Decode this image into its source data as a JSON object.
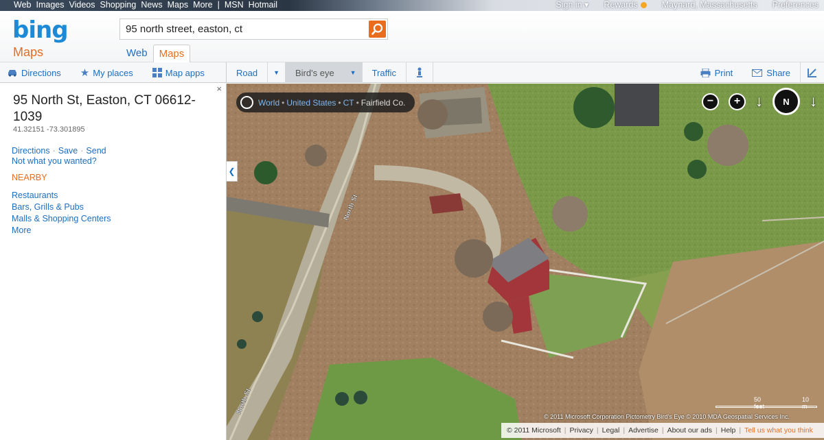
{
  "topbar": {
    "left": [
      "Web",
      "Images",
      "Videos",
      "Shopping",
      "News",
      "Maps",
      "More",
      "|",
      "MSN",
      "Hotmail"
    ],
    "sign_in": "Sign in ▾",
    "rewards": "Rewards",
    "location": "Maynard, Massachusetts",
    "preferences": "Preferences"
  },
  "header": {
    "logo": "bing",
    "logo_sub": "Maps",
    "search_value": "95 north street, easton, ct",
    "tabs": [
      "Web",
      "Maps"
    ],
    "active_tab": "Maps"
  },
  "toolbar": {
    "directions": "Directions",
    "my_places": "My places",
    "map_apps": "Map apps",
    "road": "Road",
    "birds_eye": "Bird's eye",
    "traffic": "Traffic",
    "print": "Print",
    "share": "Share"
  },
  "sidebar": {
    "address": "95 North St, Easton, CT 06612-1039",
    "coordinates": "41.32151 -73.301895",
    "close": "×",
    "action_directions": "Directions",
    "action_save": "Save",
    "action_send": "Send",
    "not_wanted": "Not what you wanted?",
    "nearby_heading": "NEARBY",
    "nearby": [
      "Restaurants",
      "Bars, Grills & Pubs",
      "Malls & Shopping Centers",
      "More"
    ]
  },
  "map": {
    "breadcrumb": [
      "World",
      "United States",
      "CT",
      "Fairfield Co."
    ],
    "road_label_1": "North St",
    "road_label_2": "North St",
    "compass_label": "N",
    "scale_left": "50 feet",
    "scale_right": "10 m",
    "imagery_credit": "© 2011 Microsoft Corporation   Pictometry Bird's Eye © 2010 MDA Geospatial Services Inc."
  },
  "footer": {
    "copyright": "© 2011 Microsoft",
    "privacy": "Privacy",
    "legal": "Legal",
    "advertise": "Advertise",
    "about_ads": "About our ads",
    "help": "Help",
    "feedback": "Tell us what you think"
  }
}
